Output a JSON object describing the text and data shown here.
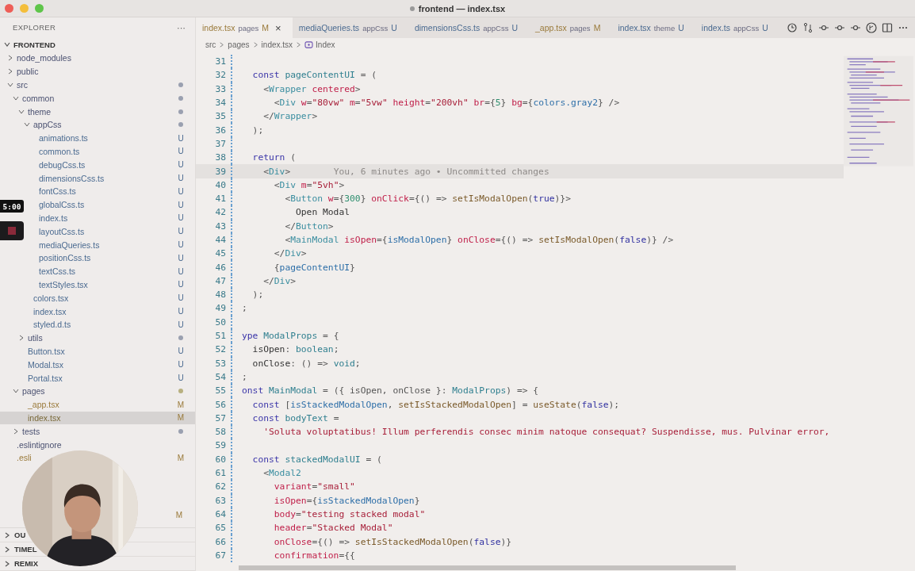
{
  "window": {
    "title": "frontend — index.tsx",
    "unsaved": true
  },
  "sidebar": {
    "header": "EXPLORER",
    "more": "···",
    "root": {
      "label": "FRONTEND",
      "expanded": true
    },
    "tree": [
      {
        "label": "node_modules",
        "expanded": false,
        "selected": false
      },
      {
        "label": "public",
        "expanded": false,
        "selected": false
      },
      {
        "label": "src",
        "expanded": true,
        "selected": false,
        "color": "#9aa0b0",
        "children": [
          {
            "label": "common",
            "expanded": true,
            "selected": false,
            "color": "#9aa0b0",
            "children": [
              {
                "label": "theme",
                "expanded": true,
                "selected": false,
                "color": "#9aa0b0",
                "children": [
                  {
                    "label": "appCss",
                    "expanded": true,
                    "selected": false,
                    "color": "#9aa0b0",
                    "children": [
                      {
                        "label": "animations.ts",
                        "status": "U",
                        "selected": false
                      },
                      {
                        "label": "common.ts",
                        "status": "U",
                        "selected": false
                      },
                      {
                        "label": "debugCss.ts",
                        "status": "U",
                        "selected": false
                      },
                      {
                        "label": "dimensionsCss.ts",
                        "status": "U",
                        "selected": false
                      },
                      {
                        "label": "fontCss.ts",
                        "status": "U",
                        "selected": false
                      },
                      {
                        "label": "globalCss.ts",
                        "status": "U",
                        "selected": false
                      },
                      {
                        "label": "index.ts",
                        "status": "U",
                        "selected": false
                      },
                      {
                        "label": "layoutCss.ts",
                        "status": "U",
                        "selected": false
                      },
                      {
                        "label": "mediaQueries.ts",
                        "status": "U",
                        "selected": false
                      },
                      {
                        "label": "positionCss.ts",
                        "status": "U",
                        "selected": false
                      },
                      {
                        "label": "textCss.ts",
                        "status": "U",
                        "selected": false
                      },
                      {
                        "label": "textStyles.tsx",
                        "status": "U",
                        "selected": false
                      }
                    ]
                  },
                  {
                    "label": "colors.tsx",
                    "status": "U",
                    "selected": false
                  },
                  {
                    "label": "index.tsx",
                    "status": "U",
                    "selected": false
                  },
                  {
                    "label": "styled.d.ts",
                    "status": "U",
                    "selected": false
                  }
                ]
              },
              {
                "label": "utils",
                "expanded": false,
                "selected": false,
                "color": "#9aa0b0"
              },
              {
                "label": "Button.tsx",
                "status": "U",
                "selected": false
              },
              {
                "label": "Modal.tsx",
                "status": "U",
                "selected": false
              },
              {
                "label": "Portal.tsx",
                "status": "U",
                "selected": false
              }
            ]
          },
          {
            "label": "pages",
            "expanded": true,
            "selected": false,
            "color": "#b8b080",
            "children": [
              {
                "label": "_app.tsx",
                "status": "M",
                "selected": false
              },
              {
                "label": "index.tsx",
                "status": "M",
                "selected": true
              }
            ]
          },
          {
            "label": "tests",
            "expanded": false,
            "selected": false,
            "color": "#9aa0b0"
          }
        ]
      },
      {
        "label": ".eslintignore",
        "selected": false
      },
      {
        "label": ".esli",
        "status": "M",
        "selected": false
      }
    ],
    "hidden_status": "M",
    "panels": [
      "OU",
      "TIMEL",
      "REMIX"
    ]
  },
  "tabs": [
    {
      "name": "index.tsx",
      "folder": "pages",
      "status": "M",
      "selected": true,
      "close": "×"
    },
    {
      "name": "mediaQueries.ts",
      "folder": "appCss",
      "status": "U",
      "selected": false
    },
    {
      "name": "dimensionsCss.ts",
      "folder": "appCss",
      "status": "U",
      "selected": false
    },
    {
      "name": "_app.tsx",
      "folder": "pages",
      "status": "M",
      "selected": false
    },
    {
      "name": "index.tsx",
      "folder": "theme",
      "status": "U",
      "selected": false
    },
    {
      "name": "index.ts",
      "folder": "appCss",
      "status": "U",
      "selected": false
    }
  ],
  "breadcrumbs": [
    "src",
    "pages",
    "index.tsx",
    "Index"
  ],
  "recording": {
    "time": "5:00"
  },
  "webcam": {
    "kind": "picture"
  },
  "code": [
    {
      "number": "31",
      "current": false
    },
    {
      "number": "32",
      "current": false,
      "tokens": [
        {
          "kind": "kw",
          "text": "  const"
        },
        {
          "kind": "name",
          "text": " pageContentUI"
        },
        {
          "kind": "pun",
          "text": " = ("
        }
      ]
    },
    {
      "number": "33",
      "current": false,
      "tokens": [
        {
          "kind": "pun",
          "text": "    <"
        },
        {
          "kind": "tag",
          "text": "Wrapper"
        },
        {
          "kind": "attr",
          "text": " centered"
        },
        {
          "kind": "pun",
          "text": ">"
        }
      ]
    },
    {
      "number": "34",
      "current": false,
      "tokens": [
        {
          "kind": "pun",
          "text": "      <"
        },
        {
          "kind": "tag",
          "text": "Div"
        },
        {
          "kind": "attr",
          "text": " w"
        },
        {
          "kind": "pun",
          "text": "="
        },
        {
          "kind": "str",
          "text": "\"80vw\""
        },
        {
          "kind": "attr",
          "text": " m"
        },
        {
          "kind": "pun",
          "text": "="
        },
        {
          "kind": "str",
          "text": "\"5vw\""
        },
        {
          "kind": "attr",
          "text": " height"
        },
        {
          "kind": "pun",
          "text": "="
        },
        {
          "kind": "str",
          "text": "\"200vh\""
        },
        {
          "kind": "attr",
          "text": " br"
        },
        {
          "kind": "pun",
          "text": "={"
        },
        {
          "kind": "num",
          "text": "5"
        },
        {
          "kind": "pun",
          "text": "}"
        },
        {
          "kind": "attr",
          "text": " bg"
        },
        {
          "kind": "pun",
          "text": "={"
        },
        {
          "kind": "var",
          "text": "colors.gray2"
        },
        {
          "kind": "pun",
          "text": "} />"
        }
      ]
    },
    {
      "number": "35",
      "current": false,
      "tokens": [
        {
          "kind": "pun",
          "text": "    </"
        },
        {
          "kind": "tag",
          "text": "Wrapper"
        },
        {
          "kind": "pun",
          "text": ">"
        }
      ]
    },
    {
      "number": "36",
      "current": false,
      "tokens": [
        {
          "kind": "pun",
          "text": "  );"
        }
      ]
    },
    {
      "number": "37",
      "current": false
    },
    {
      "number": "38",
      "current": false,
      "tokens": [
        {
          "kind": "kw",
          "text": "  return"
        },
        {
          "kind": "pun",
          "text": " ("
        }
      ]
    },
    {
      "number": "39",
      "current": true,
      "tokens": [
        {
          "kind": "pun",
          "text": "    <"
        },
        {
          "kind": "tag",
          "text": "Div"
        },
        {
          "kind": "pun",
          "text": ">"
        },
        {
          "kind": "ghost",
          "text": "        You, 6 minutes ago • Uncommitted changes"
        }
      ]
    },
    {
      "number": "40",
      "current": false,
      "tokens": [
        {
          "kind": "pun",
          "text": "      <"
        },
        {
          "kind": "tag",
          "text": "Div"
        },
        {
          "kind": "attr",
          "text": " m"
        },
        {
          "kind": "pun",
          "text": "="
        },
        {
          "kind": "str",
          "text": "\"5vh\""
        },
        {
          "kind": "pun",
          "text": ">"
        }
      ]
    },
    {
      "number": "41",
      "current": false,
      "tokens": [
        {
          "kind": "pun",
          "text": "        <"
        },
        {
          "kind": "tag",
          "text": "Button"
        },
        {
          "kind": "attr",
          "text": " w"
        },
        {
          "kind": "pun",
          "text": "={"
        },
        {
          "kind": "num",
          "text": "300"
        },
        {
          "kind": "pun",
          "text": "}"
        },
        {
          "kind": "attr",
          "text": " onClick"
        },
        {
          "kind": "pun",
          "text": "={() => "
        },
        {
          "kind": "fn",
          "text": "setIsModalOpen"
        },
        {
          "kind": "pun",
          "text": "("
        },
        {
          "kind": "lit",
          "text": "true"
        },
        {
          "kind": "pun",
          "text": ")}>"
        }
      ]
    },
    {
      "number": "42",
      "current": false,
      "tokens": [
        {
          "kind": "text",
          "text": "          Open Modal"
        }
      ]
    },
    {
      "number": "43",
      "current": false,
      "tokens": [
        {
          "kind": "pun",
          "text": "        </"
        },
        {
          "kind": "tag",
          "text": "Button"
        },
        {
          "kind": "pun",
          "text": ">"
        }
      ]
    },
    {
      "number": "44",
      "current": false,
      "tokens": [
        {
          "kind": "pun",
          "text": "        <"
        },
        {
          "kind": "tag",
          "text": "MainModal"
        },
        {
          "kind": "attr",
          "text": " isOpen"
        },
        {
          "kind": "pun",
          "text": "={"
        },
        {
          "kind": "var",
          "text": "isModalOpen"
        },
        {
          "kind": "pun",
          "text": "}"
        },
        {
          "kind": "attr",
          "text": " onClose"
        },
        {
          "kind": "pun",
          "text": "={() => "
        },
        {
          "kind": "fn",
          "text": "setIsModalOpen"
        },
        {
          "kind": "pun",
          "text": "("
        },
        {
          "kind": "lit",
          "text": "false"
        },
        {
          "kind": "pun",
          "text": ")} />"
        }
      ]
    },
    {
      "number": "45",
      "current": false,
      "tokens": [
        {
          "kind": "pun",
          "text": "      </"
        },
        {
          "kind": "tag",
          "text": "Div"
        },
        {
          "kind": "pun",
          "text": ">"
        }
      ]
    },
    {
      "number": "46",
      "current": false,
      "tokens": [
        {
          "kind": "pun",
          "text": "      {"
        },
        {
          "kind": "var",
          "text": "pageContentUI"
        },
        {
          "kind": "pun",
          "text": "}"
        }
      ]
    },
    {
      "number": "47",
      "current": false,
      "tokens": [
        {
          "kind": "pun",
          "text": "    </"
        },
        {
          "kind": "tag",
          "text": "Div"
        },
        {
          "kind": "pun",
          "text": ">"
        }
      ]
    },
    {
      "number": "48",
      "current": false,
      "tokens": [
        {
          "kind": "pun",
          "text": "  );"
        }
      ]
    },
    {
      "number": "49",
      "current": false,
      "tokens": [
        {
          "kind": "pun",
          "text": ";"
        }
      ]
    },
    {
      "number": "50",
      "current": false
    },
    {
      "number": "51",
      "current": false,
      "tokens": [
        {
          "kind": "kw",
          "text": "ype"
        },
        {
          "kind": "name",
          "text": " ModalProps"
        },
        {
          "kind": "pun",
          "text": " = {"
        }
      ]
    },
    {
      "number": "52",
      "current": false,
      "tokens": [
        {
          "kind": "text",
          "text": "  isOpen"
        },
        {
          "kind": "pun",
          "text": ": "
        },
        {
          "kind": "type",
          "text": "boolean"
        },
        {
          "kind": "pun",
          "text": ";"
        }
      ]
    },
    {
      "number": "53",
      "current": false,
      "tokens": [
        {
          "kind": "text",
          "text": "  onClose"
        },
        {
          "kind": "pun",
          "text": ": () => "
        },
        {
          "kind": "type",
          "text": "void"
        },
        {
          "kind": "pun",
          "text": ";"
        }
      ]
    },
    {
      "number": "54",
      "current": false,
      "tokens": [
        {
          "kind": "pun",
          "text": ";"
        }
      ]
    },
    {
      "number": "55",
      "current": false,
      "tokens": [
        {
          "kind": "kw",
          "text": "onst"
        },
        {
          "kind": "name",
          "text": " MainModal"
        },
        {
          "kind": "pun",
          "text": " = ({ isOpen, onClose }: "
        },
        {
          "kind": "type",
          "text": "ModalProps"
        },
        {
          "kind": "pun",
          "text": ") => {"
        }
      ]
    },
    {
      "number": "56",
      "current": false,
      "tokens": [
        {
          "kind": "kw",
          "text": "  const"
        },
        {
          "kind": "pun",
          "text": " ["
        },
        {
          "kind": "var",
          "text": "isStackedModalOpen"
        },
        {
          "kind": "pun",
          "text": ", "
        },
        {
          "kind": "fn",
          "text": "setIsStackedModalOpen"
        },
        {
          "kind": "pun",
          "text": "] = "
        },
        {
          "kind": "fn",
          "text": "useState"
        },
        {
          "kind": "pun",
          "text": "("
        },
        {
          "kind": "lit",
          "text": "false"
        },
        {
          "kind": "pun",
          "text": ");"
        }
      ]
    },
    {
      "number": "57",
      "current": false,
      "tokens": [
        {
          "kind": "kw",
          "text": "  const"
        },
        {
          "kind": "name",
          "text": " bodyText"
        },
        {
          "kind": "pun",
          "text": " ="
        }
      ]
    },
    {
      "number": "58",
      "current": false,
      "tokens": [
        {
          "kind": "str",
          "text": "    'Soluta voluptatibus! Illum perferendis consec minim natoque consequat? Suspendisse, mus. Pulvinar error,"
        }
      ]
    },
    {
      "number": "59",
      "current": false
    },
    {
      "number": "60",
      "current": false,
      "tokens": [
        {
          "kind": "kw",
          "text": "  const"
        },
        {
          "kind": "name",
          "text": " stackedModalUI"
        },
        {
          "kind": "pun",
          "text": " = ("
        }
      ]
    },
    {
      "number": "61",
      "current": false,
      "tokens": [
        {
          "kind": "pun",
          "text": "    <"
        },
        {
          "kind": "tag",
          "text": "Modal2"
        }
      ]
    },
    {
      "number": "62",
      "current": false,
      "tokens": [
        {
          "kind": "attr",
          "text": "      variant"
        },
        {
          "kind": "pun",
          "text": "="
        },
        {
          "kind": "str",
          "text": "\"small\""
        }
      ]
    },
    {
      "number": "63",
      "current": false,
      "tokens": [
        {
          "kind": "attr",
          "text": "      isOpen"
        },
        {
          "kind": "pun",
          "text": "={"
        },
        {
          "kind": "var",
          "text": "isStackedModalOpen"
        },
        {
          "kind": "pun",
          "text": "}"
        }
      ]
    },
    {
      "number": "64",
      "current": false,
      "tokens": [
        {
          "kind": "attr",
          "text": "      body"
        },
        {
          "kind": "pun",
          "text": "="
        },
        {
          "kind": "str",
          "text": "\"testing stacked modal\""
        }
      ]
    },
    {
      "number": "65",
      "current": false,
      "tokens": [
        {
          "kind": "attr",
          "text": "      header"
        },
        {
          "kind": "pun",
          "text": "="
        },
        {
          "kind": "str",
          "text": "\"Stacked Modal\""
        }
      ]
    },
    {
      "number": "66",
      "current": false,
      "tokens": [
        {
          "kind": "attr",
          "text": "      onClose"
        },
        {
          "kind": "pun",
          "text": "={() => "
        },
        {
          "kind": "fn",
          "text": "setIsStackedModalOpen"
        },
        {
          "kind": "pun",
          "text": "("
        },
        {
          "kind": "lit",
          "text": "false"
        },
        {
          "kind": "pun",
          "text": ")}"
        }
      ]
    },
    {
      "number": "67",
      "current": false,
      "tokens": [
        {
          "kind": "attr",
          "text": "      confirmation"
        },
        {
          "kind": "pun",
          "text": "={{"
        }
      ]
    }
  ]
}
